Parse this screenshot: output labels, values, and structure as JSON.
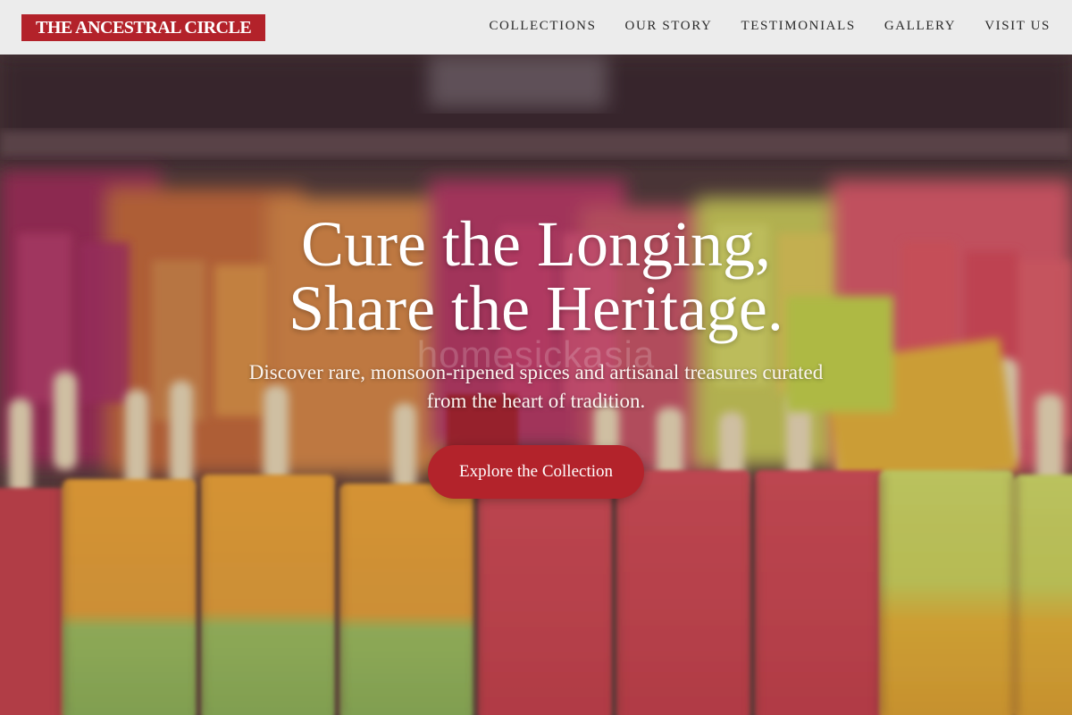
{
  "brand": {
    "name": "THE ANCESTRAL CIRCLE",
    "color": "#b3222a"
  },
  "nav": {
    "items": [
      {
        "label": "COLLECTIONS"
      },
      {
        "label": "OUR STORY"
      },
      {
        "label": "TESTIMONIALS"
      },
      {
        "label": "GALLERY"
      },
      {
        "label": "VISIT US"
      }
    ]
  },
  "hero": {
    "title_line1": "Cure the Longing,",
    "title_line2": "Share the Heritage.",
    "subtitle_line1": "Discover rare, monsoon-ripened spices and artisanal treasures curated",
    "subtitle_line2": "from the heart of tradition.",
    "cta_label": "Explore the Collection",
    "cta_color": "#b3232b",
    "background_image": "blurred display of colorful popsicles (ice-lollies) on wooden sticks",
    "watermark": "homesickasia"
  }
}
